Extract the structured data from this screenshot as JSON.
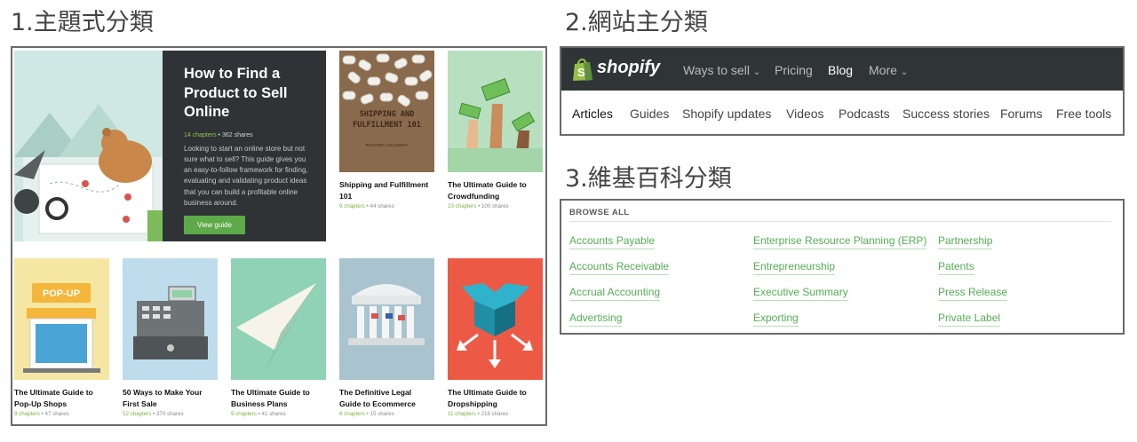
{
  "titles": {
    "s1": "1.主題式分類",
    "s2": "2.網站主分類",
    "s3": "3.維基百科分類"
  },
  "guides": {
    "featured": {
      "title": "How to Find a Product to Sell Online",
      "chapters": "14 chapters",
      "shares": "362 shares",
      "description": "Looking to start an online store but not sure what to sell? This guide gives you an easy-to-follow framework for finding, evaluating and validating product ideas that you can build a profitable online business around.",
      "button_label": "View guide"
    },
    "top": [
      {
        "title": "Shipping and Fulfillment 101",
        "chapters": "9 chapters",
        "shares": "44 shares",
        "cover_text": "SHIPPING AND FULFILLMENT 101",
        "cover_author": "RICHARD LAZAZZERA"
      },
      {
        "title": "The Ultimate Guide to Crowdfunding",
        "chapters": "23 chapters",
        "shares": "100 shares"
      }
    ],
    "bottom": [
      {
        "title": "The Ultimate Guide to Pop-Up Shops",
        "chapters": "9 chapters",
        "shares": "47 shares",
        "sign": "POP-UP"
      },
      {
        "title": "50 Ways to Make Your First Sale",
        "chapters": "52 chapters",
        "shares": "370 shares"
      },
      {
        "title": "The Ultimate Guide to Business Plans",
        "chapters": "9 chapters",
        "shares": "41 shares"
      },
      {
        "title": "The Definitive Legal Guide to Ecommerce",
        "chapters": "6 chapters",
        "shares": "15 shares"
      },
      {
        "title": "The Ultimate Guide to Dropshipping",
        "chapters": "11 chapters",
        "shares": "218 shares"
      }
    ],
    "separator": "•"
  },
  "shopify": {
    "logo": "shopify",
    "nav": [
      "Ways to sell",
      "Pricing",
      "Blog",
      "More"
    ],
    "active_nav": "Blog",
    "subnav": [
      "Articles",
      "Guides",
      "Shopify updates",
      "Videos",
      "Podcasts",
      "Success stories",
      "Forums",
      "Free tools"
    ],
    "active_subnav": "Articles"
  },
  "wiki": {
    "heading": "BROWSE ALL",
    "columns": [
      [
        "Accounts Payable",
        "Accounts Receivable",
        "Accrual Accounting",
        "Advertising"
      ],
      [
        "Enterprise Resource Planning (ERP)",
        "Entrepreneurship",
        "Executive Summary",
        "Exporting"
      ],
      [
        "Partnership",
        "Patents",
        "Press Release",
        "Private Label"
      ]
    ]
  },
  "colors": {
    "accent_green": "#5ea94a",
    "dark_panel": "#2f3336",
    "link_green": "#55ad55"
  }
}
